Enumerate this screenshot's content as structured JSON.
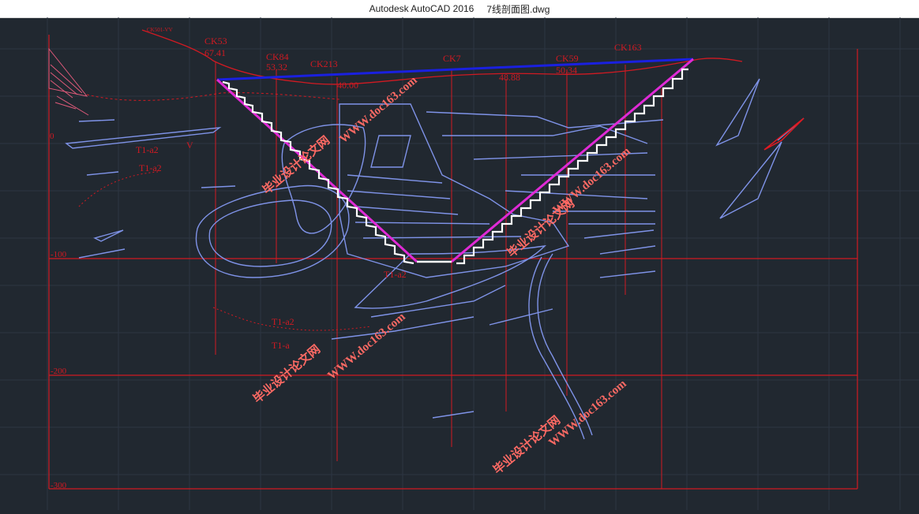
{
  "window": {
    "app_title": "Autodesk AutoCAD 2016",
    "file_name": "7线剖面图.dwg"
  },
  "drawing": {
    "elevation_labels": [
      "0",
      "-100",
      "-200",
      "-300"
    ],
    "boreholes": [
      {
        "name": "CK53",
        "value": "67.41"
      },
      {
        "name": "CK84",
        "value": "53.32"
      },
      {
        "name": "CK213",
        "value": "40.00"
      },
      {
        "name": "CK7",
        "value": ""
      },
      {
        "name": "CK59",
        "value": "50.34"
      },
      {
        "name": "CK163",
        "value": ""
      }
    ],
    "extra_values": [
      "40.00",
      "48.88"
    ],
    "stratum_labels": [
      "T1-a2",
      "T1-a2",
      "T1-a2",
      "T1-a2",
      "T1-a"
    ],
    "small_labels": [
      "V",
      "CK501-VV"
    ],
    "watermark_text": "WWW.doc163.com",
    "watermark_cn": "毕业设计论文网"
  },
  "colors": {
    "background": "#212830",
    "grid_red": "#d11a22",
    "ore_body": "#7f93e8",
    "pit_outline": "#e02ad6",
    "pit_top": "#1a20e0",
    "bench": "#ffffff",
    "watermark": "#ff6a64"
  }
}
